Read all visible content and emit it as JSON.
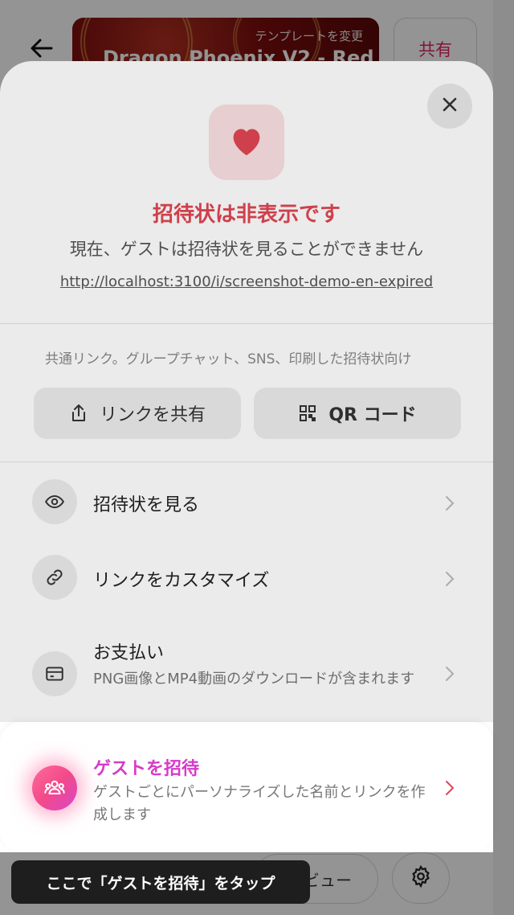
{
  "background": {
    "template_change_label": "テンプレートを変更",
    "template_name": "Dragon Phoenix V2 - Red",
    "share_label": "共有",
    "bottom_button_label": "ビュー"
  },
  "sheet": {
    "title": "招待状は非表示です",
    "subtitle": "現在、ゲストは招待状を見ることができません",
    "url": "http://localhost:3100/i/screenshot-demo-en-expired",
    "common_note": "共通リンク。グループチャット、SNS、印刷した招待状向け",
    "share_link_label": "リンクを共有",
    "qr_code_label": "QR コード",
    "rows": [
      {
        "label": "招待状を見る",
        "icon": "eye-icon"
      },
      {
        "label": "リンクをカスタマイズ",
        "icon": "link-icon"
      },
      {
        "label": "お支払い",
        "desc": "PNG画像とMP4動画のダウンロードが含まれます",
        "icon": "card-icon"
      }
    ],
    "guest": {
      "title": "ゲストを招待",
      "desc": "ゲストごとにパーソナライズした名前とリンクを作成します",
      "icon": "people-icon"
    }
  },
  "tooltip": {
    "text": "ここで「ゲストを招待」をタップ"
  },
  "colors": {
    "accent_red": "#e04652",
    "accent_pink": "#d63bc9",
    "heart_bg": "#fbe0e2"
  }
}
